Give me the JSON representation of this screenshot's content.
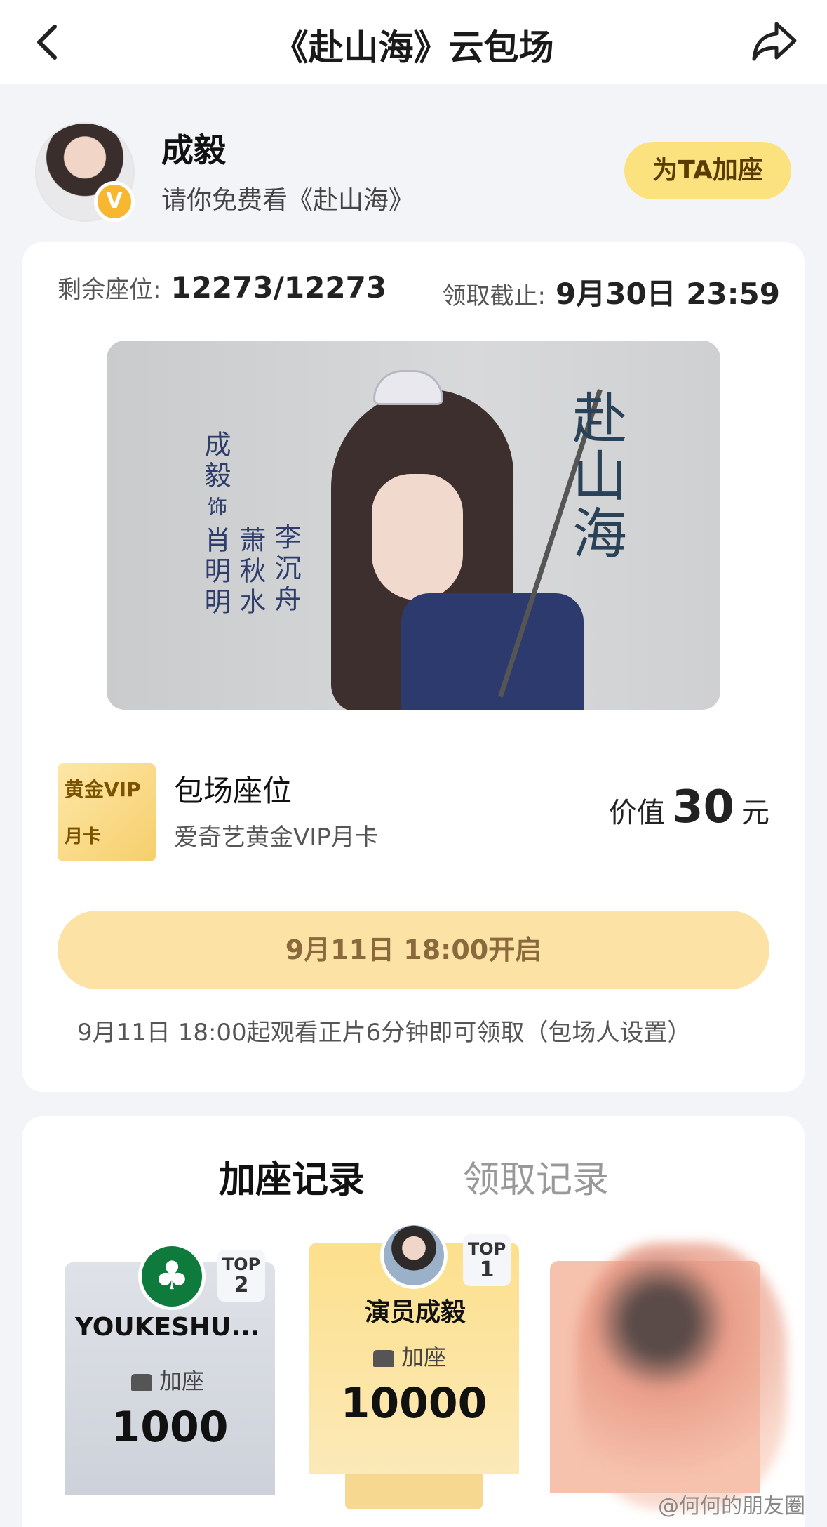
{
  "nav": {
    "title": "《赴山海》云包场",
    "back_icon": "chevron-left-icon",
    "share_icon": "share-arrow-icon"
  },
  "host": {
    "name": "成毅",
    "subtitle": "请你免费看《赴山海》",
    "verified_mark": "V",
    "add_seat_button": "为TA加座"
  },
  "event": {
    "remaining_label": "剩余座位:",
    "remaining_value": "12273/12273",
    "deadline_label": "领取截止:",
    "deadline_value": "9月30日 23:59"
  },
  "poster": {
    "actor": "成毅",
    "as": "饰",
    "role1": "肖明明",
    "role2": "萧秋水",
    "role3": "李沉舟",
    "title": "赴山海"
  },
  "benefit": {
    "icon_text1": "黄金VIP",
    "icon_text2": "月卡",
    "title": "包场座位",
    "subtitle": "爱奇艺黄金VIP月卡",
    "value_prefix": "价值",
    "value_number": "30",
    "value_unit": "元"
  },
  "open_button": "9月11日 18:00开启",
  "rule_text": "9月11日 18:00起观看正片6分钟即可领取（包场人设置）",
  "records": {
    "tab_add": "加座记录",
    "tab_claim": "领取记录",
    "ranks": [
      {
        "top_line1": "TOP",
        "top_line2": "2",
        "name": "YOUKESHU...",
        "label": "加座",
        "count": "1000"
      },
      {
        "top_line1": "TOP",
        "top_line2": "1",
        "name": "演员成毅",
        "label": "加座",
        "count": "10000"
      }
    ]
  },
  "watermark": "@何何的朋友圈",
  "colors": {
    "accent_yellow": "#fbe27e",
    "open_button": "#fde2a6",
    "background": "#f2f4f7",
    "vip_gold": "#f6cf6c"
  }
}
